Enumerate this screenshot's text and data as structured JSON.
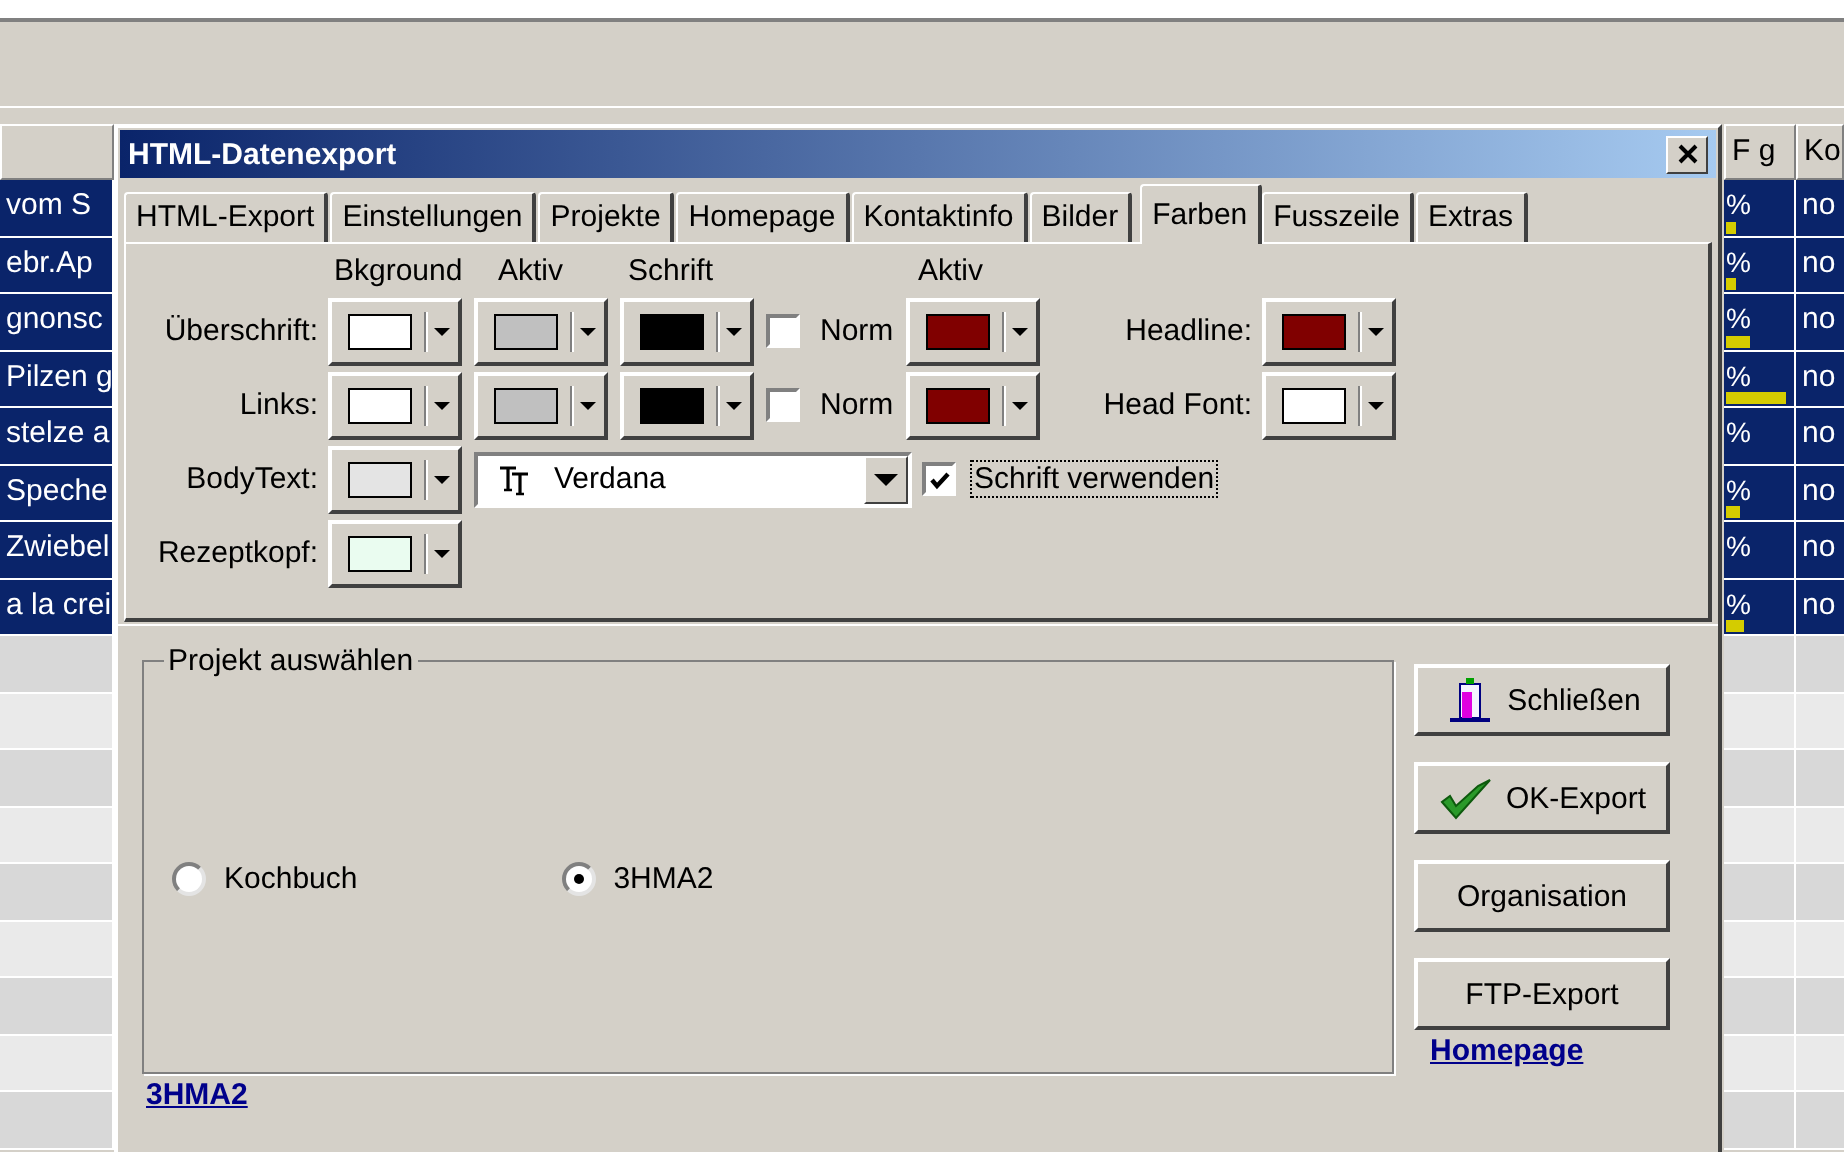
{
  "grid": {
    "columns": [
      {
        "label": "F g"
      },
      {
        "label": "Ko"
      }
    ],
    "rows": [
      {
        "name": "vom S",
        "column_2": "%",
        "level": 0.15,
        "column_3": "no"
      },
      {
        "name": "ebr.Ap",
        "column_2": "%",
        "level": 0.15,
        "column_3": "no"
      },
      {
        "name": "gnonsc",
        "column_2": "%",
        "level": 0.35,
        "column_3": "no"
      },
      {
        "name": "Pilzen g",
        "column_2": "%",
        "level": 0.85,
        "column_3": "no"
      },
      {
        "name": "stelze a",
        "column_2": "%",
        "column_3": "no"
      },
      {
        "name": "Speche",
        "column_2": "%",
        "level": 0.2,
        "column_3": "no"
      },
      {
        "name": "Zwiebel",
        "column_2": "%",
        "column_3": "no"
      },
      {
        "name": "a la crei",
        "column_2": "%",
        "level": 0.25,
        "column_3": "no"
      }
    ]
  },
  "dialog": {
    "title": "HTML-Datenexport",
    "tabs": [
      {
        "label": "HTML-Export",
        "selected": false
      },
      {
        "label": "Einstellungen",
        "selected": false
      },
      {
        "label": "Projekte",
        "selected": false
      },
      {
        "label": "Homepage",
        "selected": false
      },
      {
        "label": "Kontaktinfo",
        "selected": false
      },
      {
        "label": "Bilder",
        "selected": false
      },
      {
        "label": "Farben",
        "selected": true
      },
      {
        "label": "Fusszeile",
        "selected": false
      },
      {
        "label": "Extras",
        "selected": false
      }
    ],
    "color_headers": [
      "Bkground",
      "Aktiv",
      "Schrift",
      "Aktiv"
    ],
    "color_rows": [
      {
        "kind": "full",
        "label": "Überschrift:",
        "swatches": [
          {
            "color": "#ffffff"
          },
          {
            "color": "#c0c0c0"
          },
          {
            "color": "#000000"
          }
        ],
        "norm": {
          "label": "Norm",
          "checked": false
        },
        "active_swatch": {
          "color": "#800000"
        },
        "side": {
          "label": "Headline:",
          "color": "#800000"
        }
      },
      {
        "kind": "full",
        "label": "Links:",
        "swatches": [
          {
            "color": "#ffffff"
          },
          {
            "color": "#c0c0c0"
          },
          {
            "color": "#000000"
          }
        ],
        "norm": {
          "label": "Norm",
          "checked": false
        },
        "active_swatch": {
          "color": "#800000"
        },
        "side": {
          "label": "Head Font:",
          "color": "#ffffff"
        }
      },
      {
        "kind": "font",
        "label": "BodyText:",
        "swatches": [
          {
            "color": "#e4e4e4"
          }
        ],
        "font": "Verdana",
        "use_font": {
          "label": "Schrift verwenden",
          "checked": true
        }
      },
      {
        "kind": "single",
        "label": "Rezeptkopf:",
        "swatches": [
          {
            "color": "#eafcf0"
          }
        ]
      }
    ],
    "project_group": {
      "title": "Projekt auswählen",
      "options": [
        {
          "label": "Kochbuch",
          "selected": false
        },
        {
          "label": "3HMA2",
          "selected": true
        }
      ]
    },
    "buttons": [
      {
        "label": "Schließen",
        "kind": "exit"
      },
      {
        "label": "OK-Export",
        "kind": "check"
      },
      {
        "label": "Organisation",
        "kind": "plain"
      },
      {
        "label": "FTP-Export",
        "kind": "plain"
      }
    ],
    "homepage_link": "Homepage",
    "project_link": "3HMA2"
  }
}
